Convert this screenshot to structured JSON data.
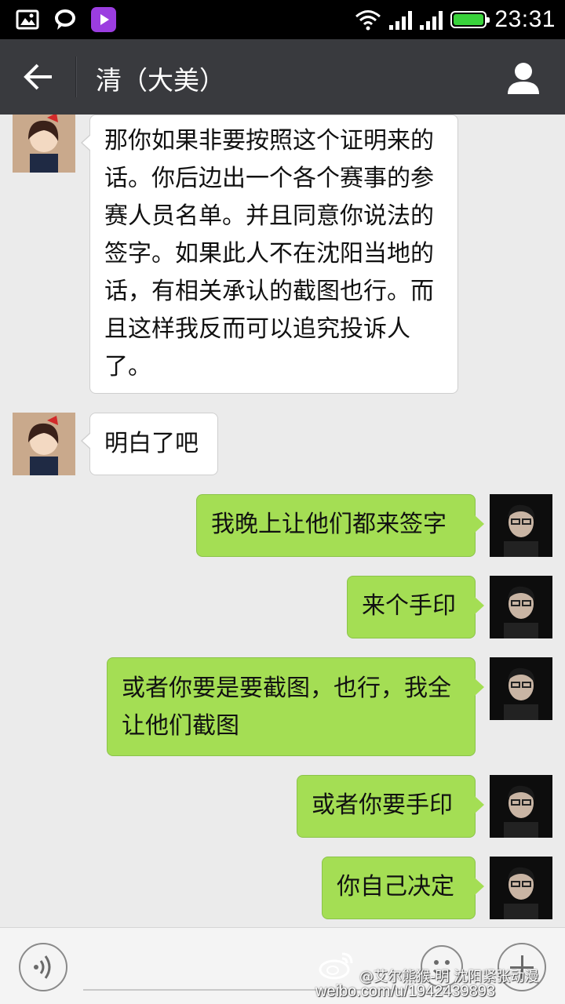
{
  "status_bar": {
    "time": "23:31",
    "icons": [
      "image-icon",
      "chat-bubble-icon",
      "video-app-icon",
      "wifi-icon",
      "signal-icon",
      "signal-icon",
      "battery-icon"
    ],
    "battery_color": "#39d23b"
  },
  "header": {
    "title": "清（大美）",
    "back_icon": "arrow-left-icon",
    "profile_icon": "person-icon",
    "background": "#393a3e"
  },
  "messages": [
    {
      "side": "left",
      "text": "那你如果非要按照这个证明来的话。你后边出一个各个赛事的参赛人员名单。并且同意你说法的签字。如果此人不在沈阳当地的话，有相关承认的截图也行。而且这样我反而可以追究投诉人了。"
    },
    {
      "side": "left",
      "text": "明白了吧"
    },
    {
      "side": "right",
      "text": "我晚上让他们都来签字"
    },
    {
      "side": "right",
      "text": "来个手印"
    },
    {
      "side": "right",
      "text": "或者你要是要截图，也行，我全让他们截图"
    },
    {
      "side": "right",
      "text": "或者你要手印"
    },
    {
      "side": "right",
      "text": "你自己决定"
    }
  ],
  "input_bar": {
    "voice_icon": "voice-icon",
    "emoji_icon": "emoji-icon",
    "plus_icon": "plus-icon"
  },
  "watermark": {
    "line1": "@艾尔熊猴-明 沈阳紧张动漫",
    "line2": "weibo.com/u/1942439893"
  },
  "colors": {
    "sent_bubble": "#a4de54",
    "received_bubble": "#ffffff",
    "chat_background": "#ebebeb"
  }
}
